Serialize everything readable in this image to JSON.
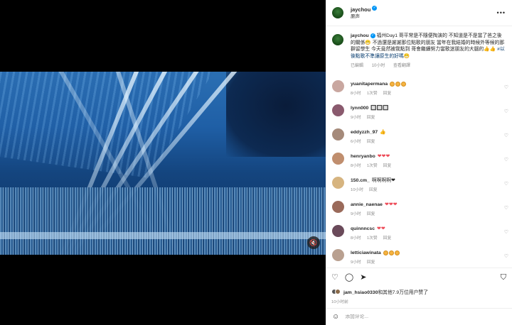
{
  "post": {
    "username": "jaychou",
    "subtitle": "原声",
    "more_icon": "more-horizontal-icon"
  },
  "caption": {
    "username": "jaychou",
    "text": "福州Day1 哥平常是不隨便掏演的 不知道是不是當了爸之後的關係😁 不過還是謝謝那位點歌的朋友 當年在我結婚的時候外等候的那群留學生 今天竟然被我點到 哥會繼續努力當歌迷朋友的大腦的👍👍",
    "hashtag": "#以後點歌不準讓原生的好嗎😁",
    "time": "已編輯",
    "ago": "10小时",
    "translate": "查看翻譯"
  },
  "comments": [
    {
      "user": "yuanitapermana",
      "text": "",
      "emoji": "faces3",
      "ago": "8小时",
      "likes": "1次赞",
      "reply": "回复",
      "avatar": "#c9a7a0"
    },
    {
      "user": "lynn000",
      "text": "🔲🔲🔲",
      "emoji": "",
      "ago": "9小时",
      "likes": "",
      "reply": "回复",
      "avatar": "#8a5a6e"
    },
    {
      "user": "eddyzzh_97",
      "text": "👍",
      "emoji": "",
      "ago": "6小时",
      "likes": "",
      "reply": "回复",
      "avatar": "#a58a7a"
    },
    {
      "user": "henryanbo",
      "text": "",
      "emoji": "hearts3",
      "ago": "8小时",
      "likes": "1次赞",
      "reply": "回复",
      "avatar": "#c08e6e"
    },
    {
      "user": "150.cm_",
      "text": "啊啊啊啊❤",
      "emoji": "",
      "ago": "10小时",
      "likes": "",
      "reply": "回复",
      "avatar": "#d6b480"
    },
    {
      "user": "annie_naenae",
      "text": "",
      "emoji": "hearts3",
      "ago": "9小时",
      "likes": "",
      "reply": "回复",
      "avatar": "#9a6a5a"
    },
    {
      "user": "quinnncsc",
      "text": "",
      "emoji": "hearts2",
      "ago": "8小时",
      "likes": "1次赞",
      "reply": "回复",
      "avatar": "#6a4a5a"
    },
    {
      "user": "letticiawinata",
      "text": "",
      "emoji": "faces3",
      "ago": "9小时",
      "likes": "",
      "reply": "回复",
      "avatar": "#b9a090"
    }
  ],
  "actions": {
    "like_icon": "heart-icon",
    "comment_icon": "comment-icon",
    "share_icon": "share-icon",
    "save_icon": "bookmark-icon"
  },
  "likes": {
    "user": "jam_hsiao0330",
    "text": "和其他7.9万位用户赞了"
  },
  "post_time": "10小时前",
  "add_comment": {
    "placeholder": "添加评论..."
  },
  "video": {
    "mute_icon": "mute-icon"
  }
}
